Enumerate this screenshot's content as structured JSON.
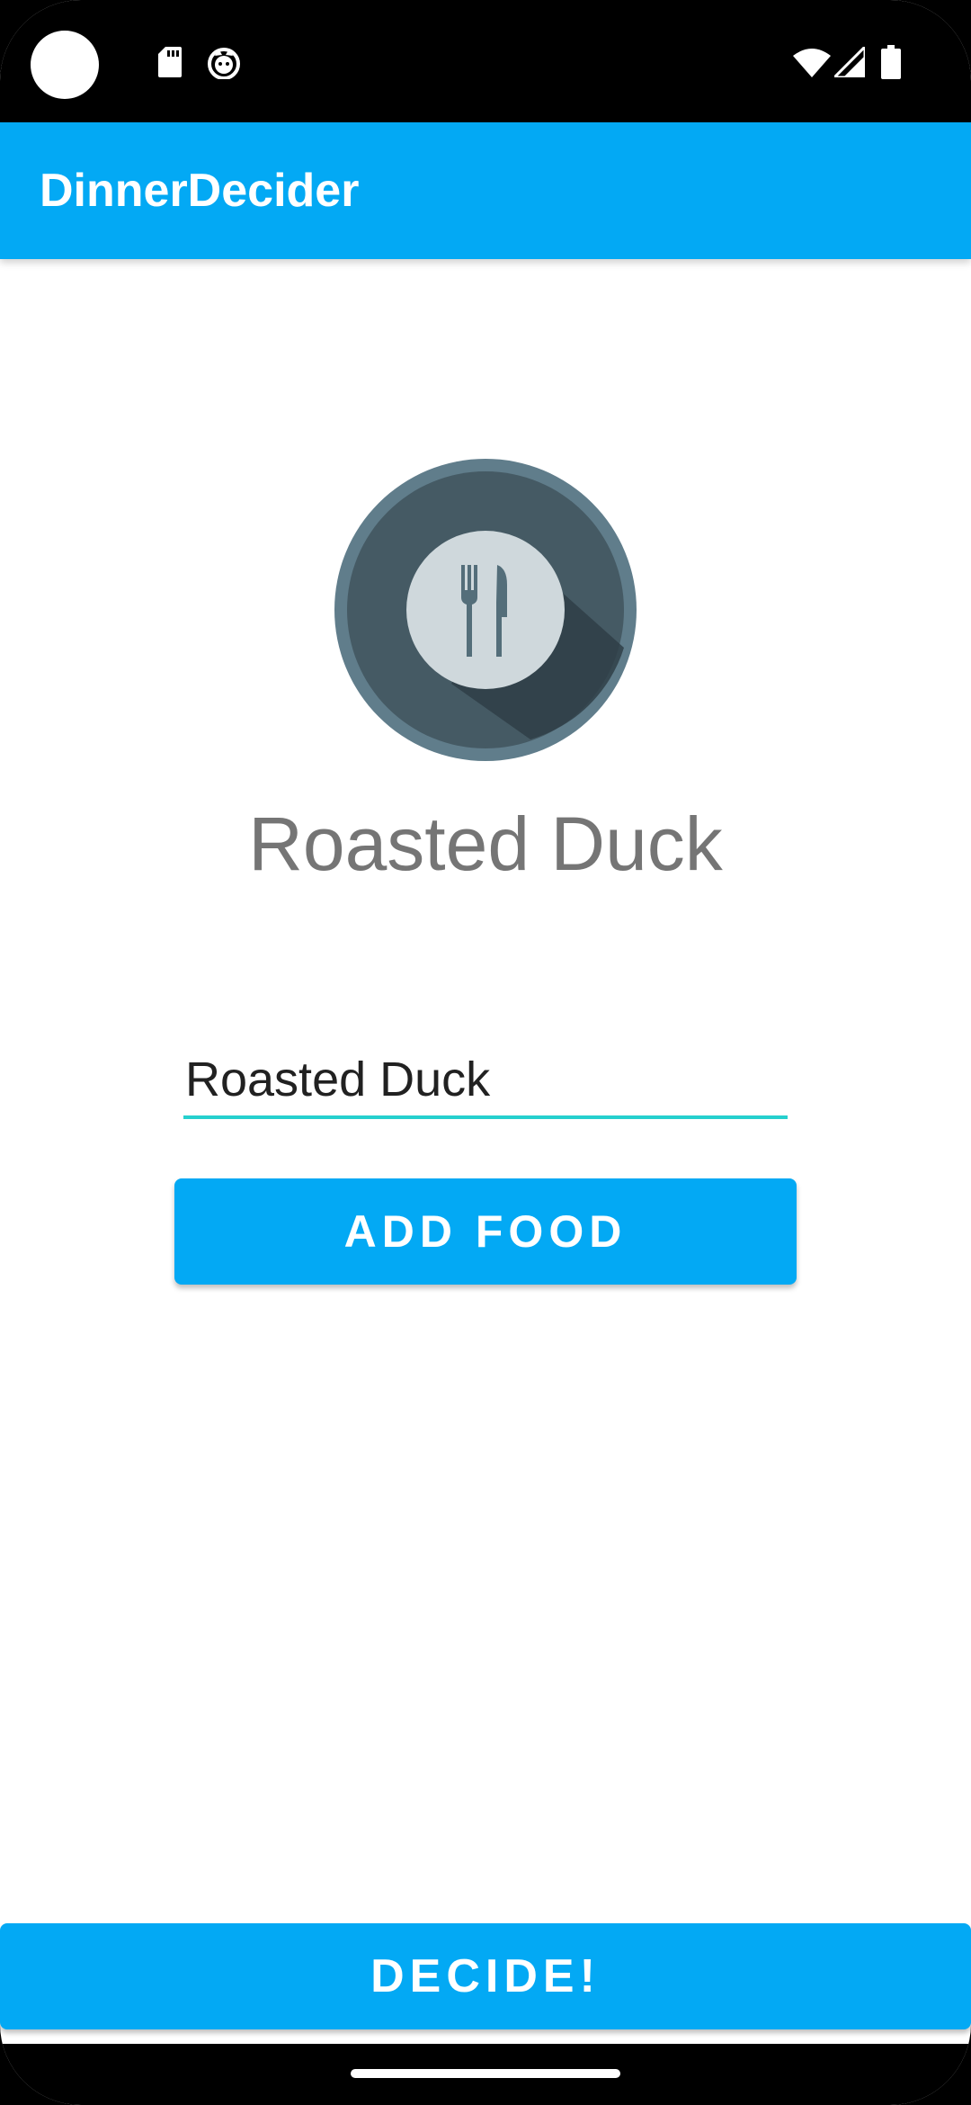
{
  "status_bar": {
    "left_icons": [
      "camera-cutout",
      "sd-card-icon",
      "cat-notification-icon"
    ],
    "right_icons": [
      "wifi-icon",
      "signal-icon",
      "battery-icon"
    ]
  },
  "app_bar": {
    "title": "DinnerDecider"
  },
  "main": {
    "food_icon": "plate-fork-knife-icon",
    "selected_food": "Roasted Duck",
    "food_input_value": "Roasted Duck",
    "add_button_label": "ADD FOOD"
  },
  "footer": {
    "decide_button_label": "DECIDE!"
  },
  "colors": {
    "primary": "#03A9F4",
    "accent": "#26D0CE",
    "icon_dark": "#455A64",
    "icon_light": "#CFD8DC"
  }
}
